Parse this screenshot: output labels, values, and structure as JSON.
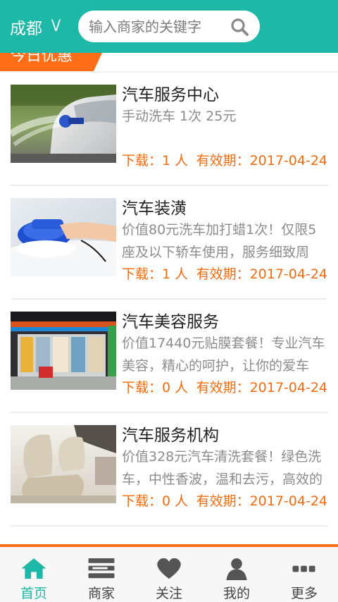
{
  "header": {
    "city": "成都",
    "city_chevron": "V",
    "search_placeholder": "输入商家的关键字",
    "search_icon": "search-icon",
    "bg_color": "#1db8a7"
  },
  "section": {
    "title": "今日优惠",
    "accent_color": "#ff6d17"
  },
  "deals": [
    {
      "title": "汽车服务中心",
      "desc": "手动洗车 1次 25元",
      "downloads": "下载：1 人",
      "valid": "有效期：2017-04-24",
      "image": "car-wash-photo"
    },
    {
      "title": "汽车装潢",
      "desc": "价值80元洗车加打蜡1次！仅限5座及以下轿车使用，服务细致周",
      "downloads": "下载：1 人",
      "valid": "有效期：2017-04-24",
      "image": "car-polishing-photo"
    },
    {
      "title": "汽车美容服务",
      "desc": "价值17440元贴膜套餐！专业汽车美容，精心的呵护，让你的爱车",
      "downloads": "下载：0 人",
      "valid": "有效期：2017-04-24",
      "image": "car-beauty-shop-photo"
    },
    {
      "title": "汽车服务机构",
      "desc": "价值328元汽车清洗套餐！绿色洗车，中性香波，温和去污，高效的",
      "downloads": "下载：0 人",
      "valid": "有效期：2017-04-24",
      "image": "car-interior-photo"
    }
  ],
  "tabbar": {
    "tabs": [
      {
        "label": "首页",
        "icon": "home-icon",
        "active": true
      },
      {
        "label": "商家",
        "icon": "store-list-icon",
        "active": false
      },
      {
        "label": "关注",
        "icon": "heart-icon",
        "active": false
      },
      {
        "label": "我的",
        "icon": "user-icon",
        "active": false
      },
      {
        "label": "更多",
        "icon": "more-dots-icon",
        "active": false
      }
    ],
    "active_color": "#1db8a7"
  }
}
